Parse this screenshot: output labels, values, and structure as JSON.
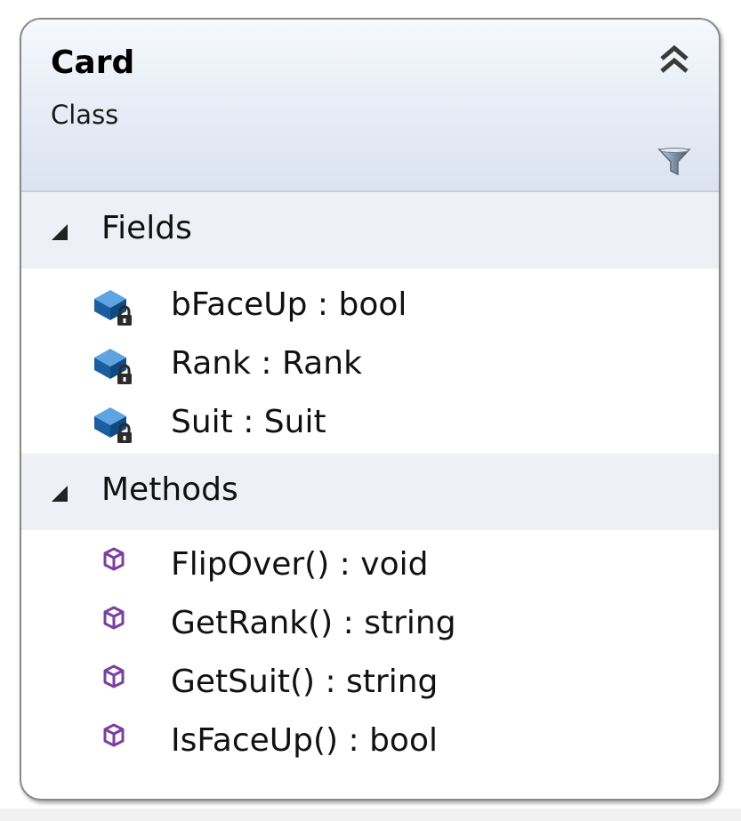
{
  "class": {
    "name": "Card",
    "kind": "Class"
  },
  "icons": {
    "collapse": "double-chevron-up-icon",
    "filter": "funnel-filter-icon",
    "field": "private-field-icon",
    "method": "method-cube-icon"
  },
  "colors": {
    "field_icon": "#1f6db3",
    "method_icon": "#7b3fa0",
    "header_gradient_top": "#f6f8fc",
    "header_gradient_bottom": "#dbe3f1"
  },
  "sections": {
    "fields": {
      "title": "Fields",
      "items": [
        {
          "label": "bFaceUp : bool"
        },
        {
          "label": "Rank : Rank"
        },
        {
          "label": "Suit : Suit"
        }
      ]
    },
    "methods": {
      "title": "Methods",
      "items": [
        {
          "label": "FlipOver() : void"
        },
        {
          "label": "GetRank() : string"
        },
        {
          "label": "GetSuit() : string"
        },
        {
          "label": "IsFaceUp() : bool"
        }
      ]
    }
  }
}
